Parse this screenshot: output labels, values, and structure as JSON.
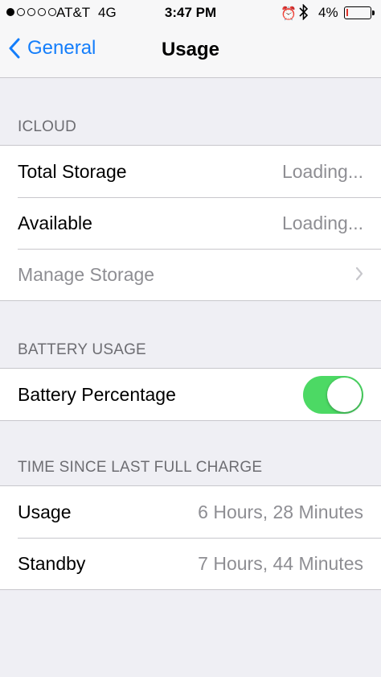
{
  "status_bar": {
    "carrier": "AT&T",
    "network": "4G",
    "time": "3:47 PM",
    "battery_percent": "4%",
    "battery_level": 0.04,
    "signal_bars": 1,
    "alarm_icon": "alarm-clock-icon",
    "bluetooth_icon": "bluetooth-icon"
  },
  "nav": {
    "back_label": "General",
    "title": "Usage"
  },
  "sections": {
    "icloud": {
      "header": "ICLOUD",
      "total_storage": {
        "label": "Total Storage",
        "value": "Loading..."
      },
      "available": {
        "label": "Available",
        "value": "Loading..."
      },
      "manage": {
        "label": "Manage Storage"
      }
    },
    "battery": {
      "header": "BATTERY USAGE",
      "percentage": {
        "label": "Battery Percentage",
        "on": true
      }
    },
    "charge": {
      "header": "TIME SINCE LAST FULL CHARGE",
      "usage": {
        "label": "Usage",
        "value": "6 Hours, 28 Minutes"
      },
      "standby": {
        "label": "Standby",
        "value": "7 Hours, 44 Minutes"
      }
    }
  },
  "colors": {
    "accent": "#147efb",
    "toggle_on": "#4cd964",
    "battery_low": "#e0332b",
    "background": "#efeff4"
  }
}
